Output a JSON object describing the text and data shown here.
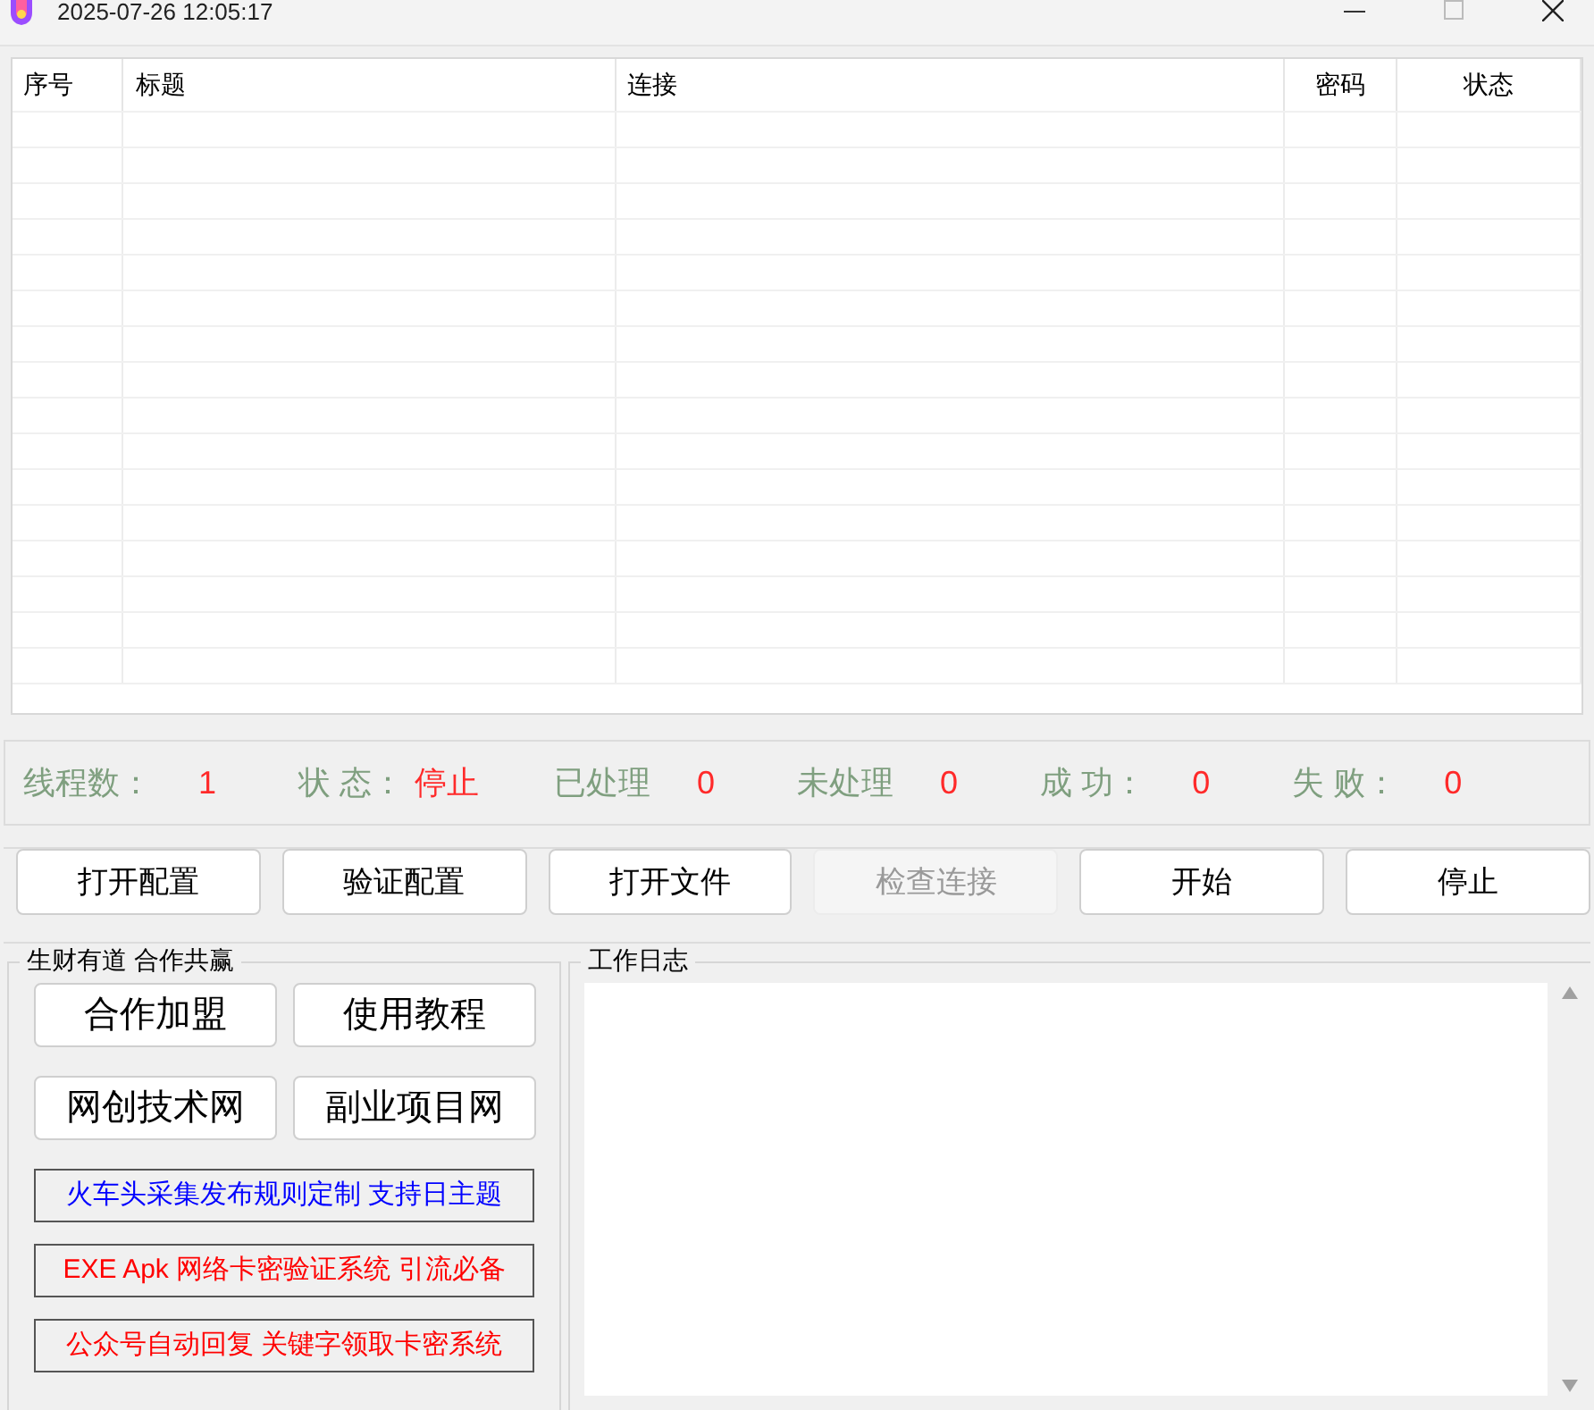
{
  "window": {
    "title": "2025-07-26 12:05:17"
  },
  "table": {
    "columns": [
      "序号",
      "标题",
      "连接",
      "密码",
      "状态"
    ]
  },
  "stats": [
    {
      "label": "线程数：",
      "value": "1"
    },
    {
      "label": "状 态：",
      "value": "停止"
    },
    {
      "label": "已处理",
      "value": "0"
    },
    {
      "label": "未处理",
      "value": "0"
    },
    {
      "label": "成 功：",
      "value": "0"
    },
    {
      "label": "失 败：",
      "value": "0"
    }
  ],
  "buttons": [
    {
      "label": "打开配置",
      "disabled": false
    },
    {
      "label": "验证配置",
      "disabled": false
    },
    {
      "label": "打开文件",
      "disabled": false
    },
    {
      "label": "检查连接",
      "disabled": true
    },
    {
      "label": "开始",
      "disabled": false
    },
    {
      "label": "停止",
      "disabled": false
    }
  ],
  "promo": {
    "title": "生财有道 合作共赢",
    "buttons": [
      "合作加盟",
      "使用教程",
      "网创技术网",
      "副业项目网"
    ],
    "links": [
      {
        "text": "火车头采集发布规则定制 支持日主题",
        "color": "#0000ff"
      },
      {
        "text": "EXE Apk 网络卡密验证系统 引流必备",
        "color": "#ff0000"
      },
      {
        "text": "公众号自动回复 关键字领取卡密系统",
        "color": "#ff0000"
      }
    ]
  },
  "log": {
    "title": "工作日志"
  }
}
